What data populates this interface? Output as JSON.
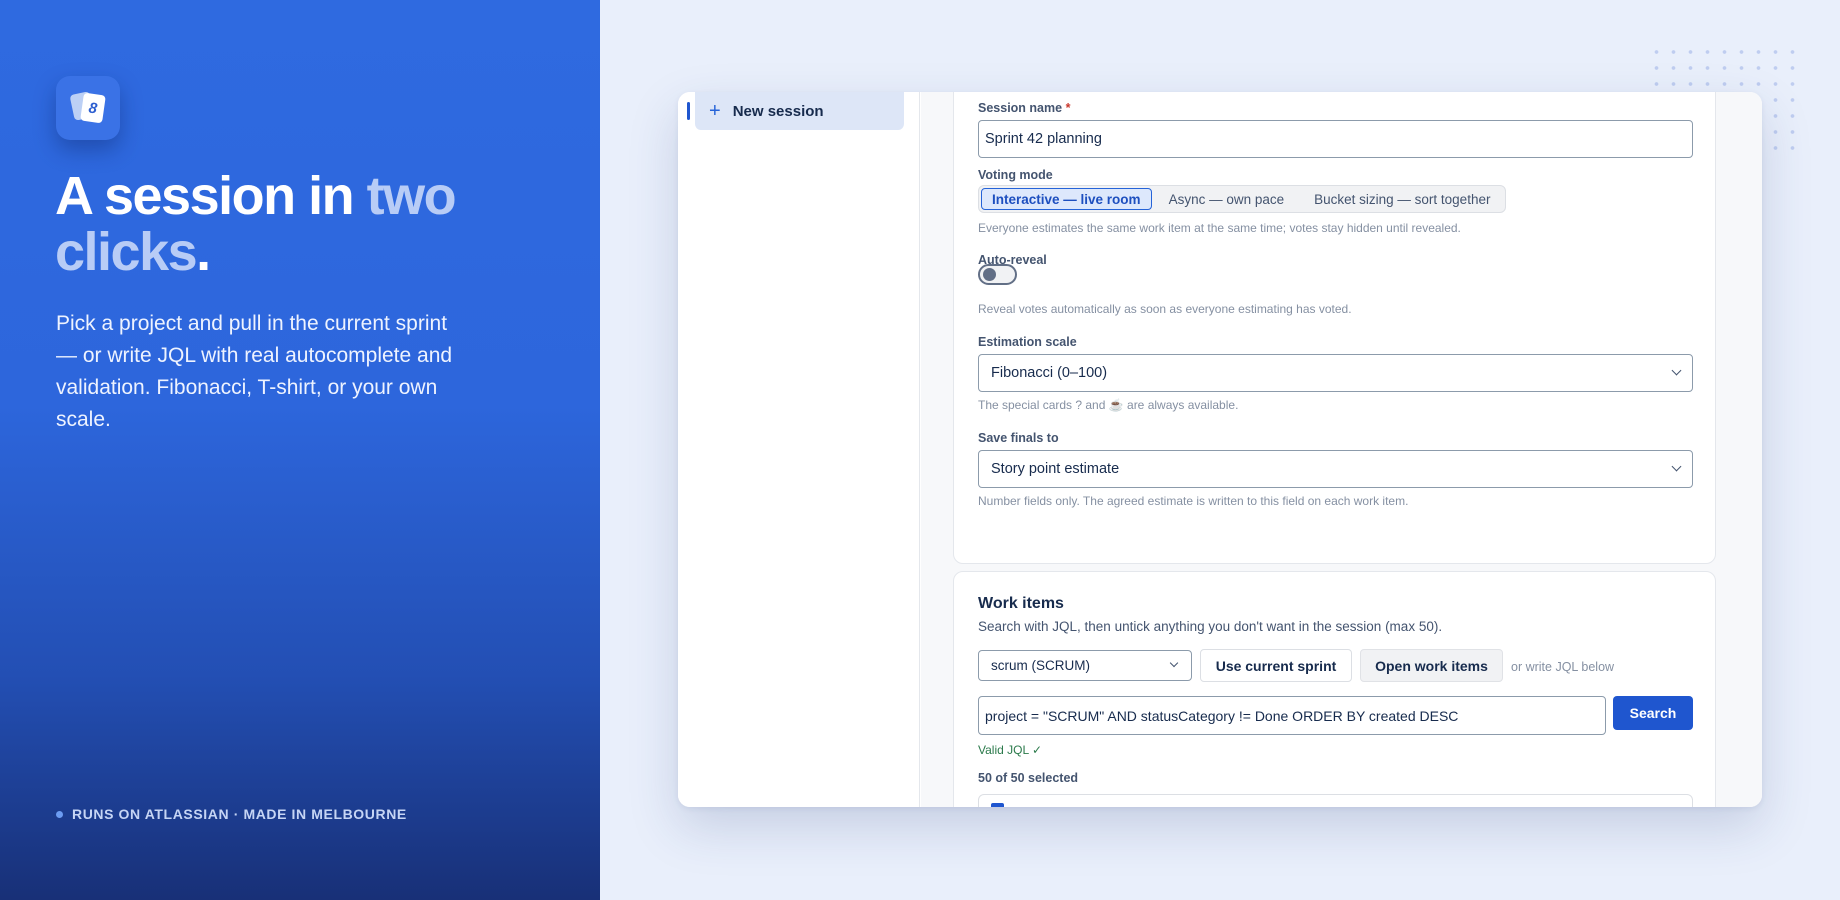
{
  "hero": {
    "title_main": "A session in ",
    "title_accent_1": "two",
    "title_accent_2": "clicks",
    "title_end": ".",
    "lead": "Pick a project and pull in the current sprint — or write JQL with real autocomplete and validation. Fibonacci, T-shirt, or your own scale.",
    "footer": "RUNS ON ATLASSIAN · MADE IN MELBOURNE",
    "logo_glyph": "8"
  },
  "sidebar": {
    "items": [
      {
        "label": "New session",
        "icon": "plus-icon",
        "glyph": "+"
      }
    ]
  },
  "form": {
    "session_name": {
      "label": "Session name",
      "required_mark": "*",
      "value": "Sprint 42 planning"
    },
    "voting_mode": {
      "label": "Voting mode",
      "options": [
        "Interactive — live room",
        "Async — own pace",
        "Bucket sizing — sort together"
      ],
      "selected": "Interactive — live room",
      "help": "Everyone estimates the same work item at the same time; votes stay hidden until revealed."
    },
    "auto_reveal": {
      "label": "Auto-reveal",
      "enabled": false,
      "help": "Reveal votes automatically as soon as everyone estimating has voted."
    },
    "estimation_scale": {
      "label": "Estimation scale",
      "value": "Fibonacci (0–100)",
      "help": "The special cards ? and ☕ are always available."
    },
    "save_finals": {
      "label": "Save finals to",
      "value": "Story point estimate",
      "help": "Number fields only. The agreed estimate is written to this field on each work item."
    }
  },
  "work_items": {
    "title": "Work items",
    "subtitle": "Search with JQL, then untick anything you don't want in the session (max 50).",
    "project": "scrum (SCRUM)",
    "use_sprint_label": "Use current sprint",
    "open_items_label": "Open work items",
    "or_jql": "or write JQL below",
    "jql": "project = \"SCRUM\" AND statusCategory != Done ORDER BY created DESC",
    "search_label": "Search",
    "valid": "Valid JQL ✓",
    "selected_count": "50 of 50 selected"
  },
  "colors": {
    "accent": "#1f56cf",
    "hero_top": "#2f6ae0",
    "hero_bottom": "#183077",
    "valid_green": "#2b7a4b",
    "required_red": "#c9372c"
  }
}
